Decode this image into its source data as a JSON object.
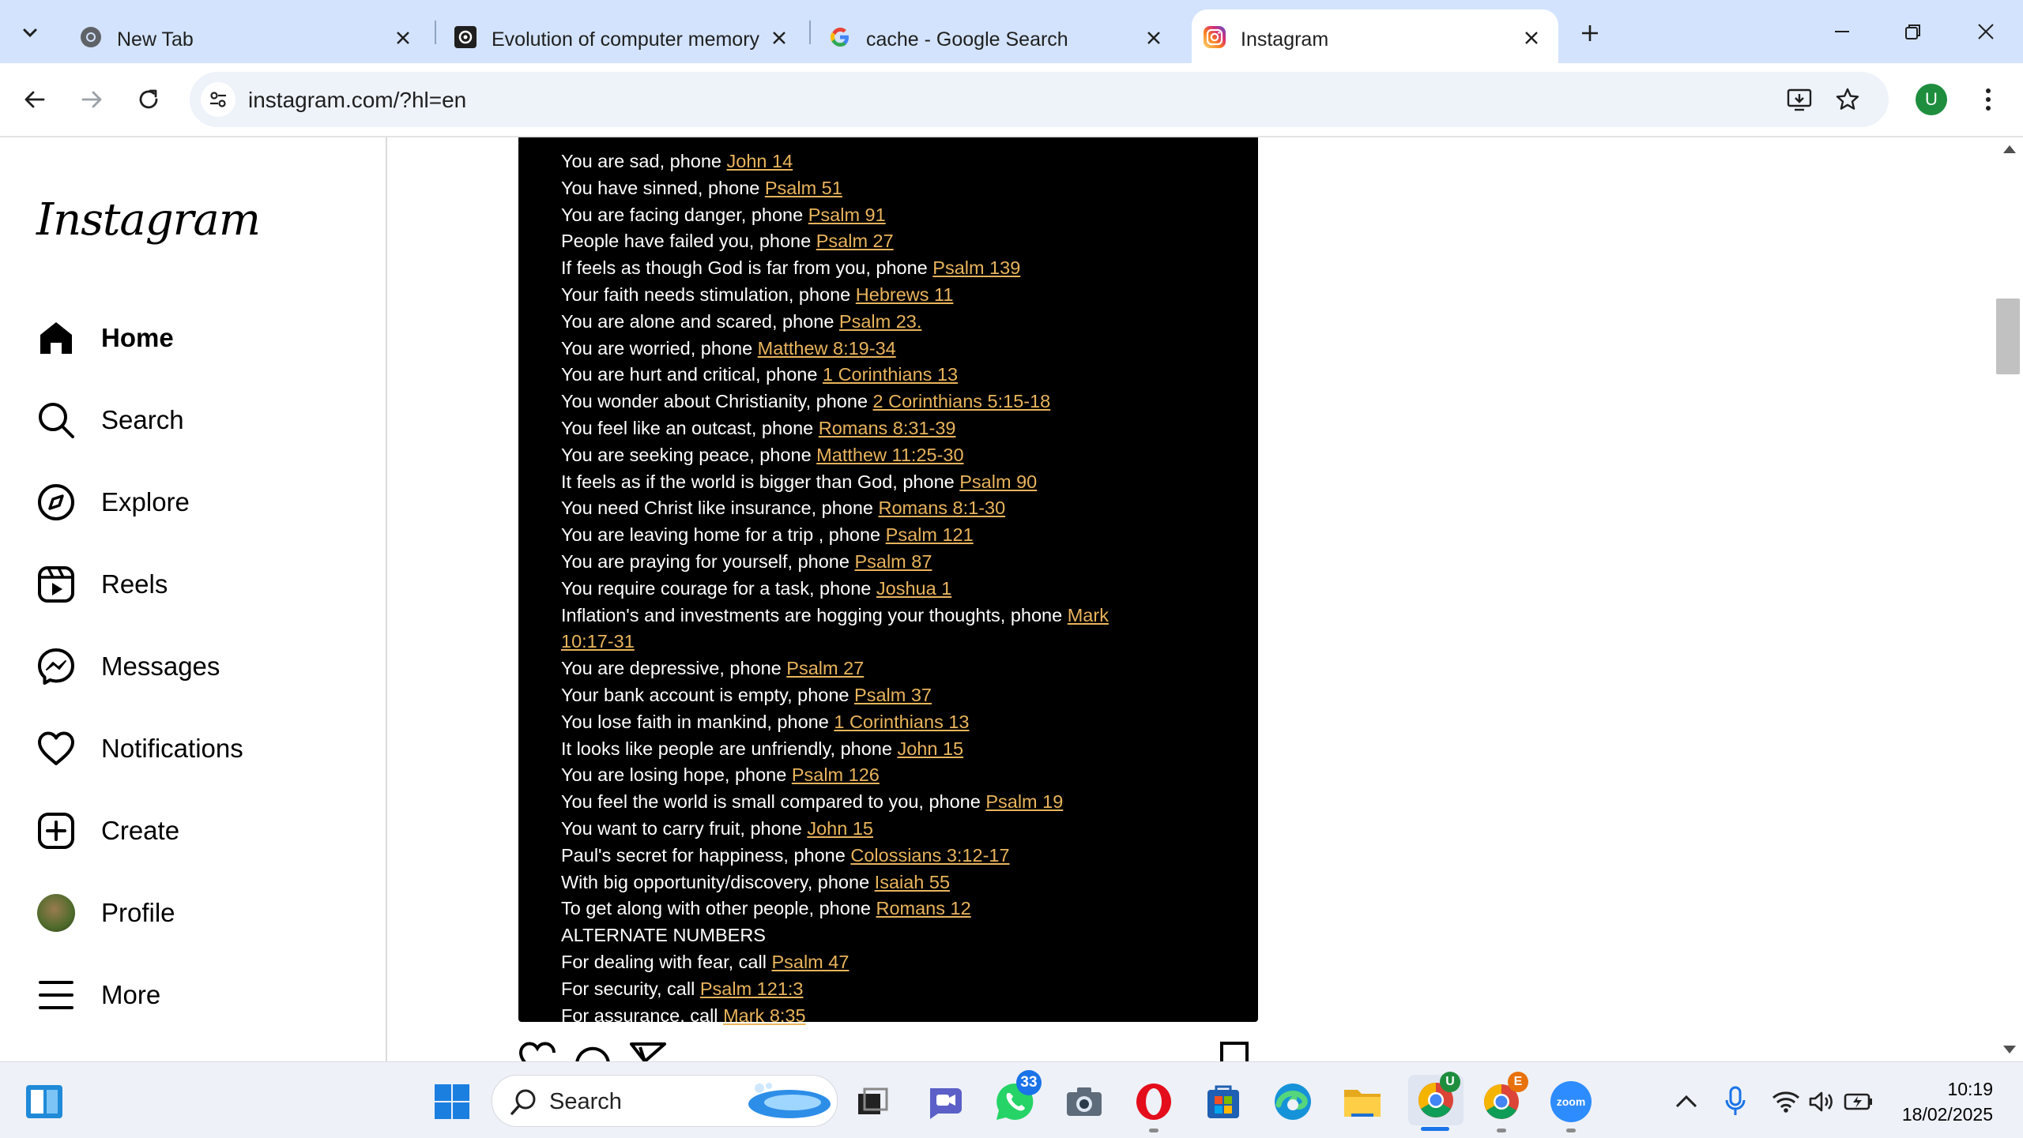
{
  "browser": {
    "tabs": [
      {
        "title": "New Tab",
        "favicon": "chrome-icon",
        "active": false
      },
      {
        "title": "Evolution of computer memory",
        "favicon": "notion-style-icon",
        "active": false
      },
      {
        "title": "cache - Google Search",
        "favicon": "google-icon",
        "active": false
      },
      {
        "title": "Instagram",
        "favicon": "instagram-icon",
        "active": true
      }
    ],
    "url": "instagram.com/?hl=en",
    "profile_initial": "U",
    "colors": {
      "tabstrip": "#d3e3fd",
      "omnibox": "#eef2f9",
      "profile": "#1e8e3e"
    }
  },
  "instagram": {
    "logo": "Instagram",
    "nav": [
      {
        "label": "Home",
        "icon": "home-icon",
        "active": true
      },
      {
        "label": "Search",
        "icon": "search-icon",
        "active": false
      },
      {
        "label": "Explore",
        "icon": "compass-icon",
        "active": false
      },
      {
        "label": "Reels",
        "icon": "reels-icon",
        "active": false
      },
      {
        "label": "Messages",
        "icon": "messenger-icon",
        "active": false
      },
      {
        "label": "Notifications",
        "icon": "heart-icon",
        "active": false
      },
      {
        "label": "Create",
        "icon": "plus-square-icon",
        "active": false
      },
      {
        "label": "Profile",
        "icon": "avatar",
        "active": false
      },
      {
        "label": "More",
        "icon": "menu-icon",
        "active": false
      }
    ],
    "post": {
      "lines": [
        {
          "text": "You are sad, phone ",
          "ref": "John 14"
        },
        {
          "text": "You have sinned, phone ",
          "ref": "Psalm 51"
        },
        {
          "text": "You are facing danger, phone ",
          "ref": "Psalm 91"
        },
        {
          "text": "People have failed you, phone ",
          "ref": "Psalm 27"
        },
        {
          "text": "If feels as though God is far from you, phone ",
          "ref": "Psalm 139"
        },
        {
          "text": "Your faith needs stimulation, phone ",
          "ref": "Hebrews 11"
        },
        {
          "text": "You are alone and scared, phone ",
          "ref": "Psalm 23."
        },
        {
          "text": "You are worried, phone ",
          "ref": "Matthew 8:19-34"
        },
        {
          "text": "You are hurt and critical, phone ",
          "ref": "1 Corinthians 13"
        },
        {
          "text": "You wonder about Christianity, phone ",
          "ref": "2 Corinthians 5:15-18"
        },
        {
          "text": "You feel like an outcast, phone ",
          "ref": "Romans 8:31-39"
        },
        {
          "text": "You are seeking peace, phone ",
          "ref": "Matthew 11:25-30"
        },
        {
          "text": "It feels as if the world is bigger than God, phone ",
          "ref": "Psalm 90"
        },
        {
          "text": "You need Christ like insurance, phone ",
          "ref": "Romans 8:1-30"
        },
        {
          "text": "You are leaving home for a trip , phone ",
          "ref": "Psalm 121"
        },
        {
          "text": "You are praying for yourself, phone ",
          "ref": "Psalm 87"
        },
        {
          "text": "You require courage for a task, phone ",
          "ref": "Joshua 1"
        },
        {
          "text": "Inflation's and investments are hogging your thoughts, phone ",
          "ref": "Mark"
        },
        {
          "text": "",
          "ref": "10:17-31"
        },
        {
          "text": "You are depressive, phone ",
          "ref": "Psalm 27"
        },
        {
          "text": "Your bank account is empty, phone ",
          "ref": "Psalm 37"
        },
        {
          "text": "You lose faith in mankind, phone ",
          "ref": "1 Corinthians 13"
        },
        {
          "text": "It looks like people are unfriendly, phone ",
          "ref": "John 15"
        },
        {
          "text": "You are losing hope, phone ",
          "ref": "Psalm 126"
        },
        {
          "text": "You feel the world is small compared to you, phone ",
          "ref": "Psalm 19"
        },
        {
          "text": "You want to carry fruit, phone ",
          "ref": "John 15"
        },
        {
          "text": "Paul's secret for happiness, phone ",
          "ref": "Colossians 3:12-17"
        },
        {
          "text": "With big opportunity/discovery, phone ",
          "ref": "Isaiah 55"
        },
        {
          "text": "To get along with other people, phone ",
          "ref": "Romans 12"
        },
        {
          "text": "ALTERNATE NUMBERS",
          "ref": ""
        },
        {
          "text": "For dealing with fear, call ",
          "ref": "Psalm 47"
        },
        {
          "text": "For security, call ",
          "ref": "Psalm 121:3"
        },
        {
          "text": "For assurance, call ",
          "ref": "Mark 8:35"
        }
      ],
      "colors": {
        "background": "#000000",
        "text": "#ffffff",
        "reference": "#e9b45c"
      }
    }
  },
  "taskbar": {
    "search_label": "Search",
    "whatsapp_badge": "33",
    "chrome_profile_badge": "U",
    "chrome2_profile_badge": "E",
    "zoom_label": "zoom",
    "time": "10:19",
    "date": "18/02/2025"
  }
}
